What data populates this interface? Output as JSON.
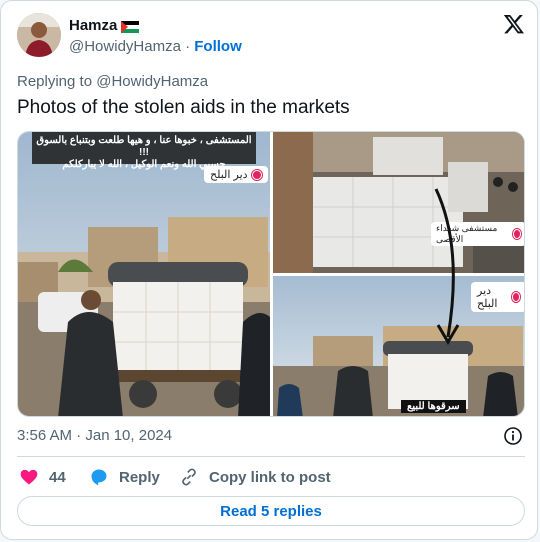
{
  "author": {
    "display_name": "Hamza",
    "handle": "@HowidyHamza",
    "separator": "·",
    "follow_label": "Follow"
  },
  "tweet": {
    "replying_to_prefix": "Replying to ",
    "replying_to_handle": "@HowidyHamza",
    "text": "Photos of the stolen aids in the markets",
    "timestamp": "3:56 AM · Jan 10, 2024"
  },
  "media": {
    "photo1_caption_lines": [
      "المستشفى ، خبوها عنا ، و هيها طلعت وبتنباع بالسوق !!!",
      "حسبي الله ونعم الوكيل ، الله لا يباركلكم"
    ],
    "photo1_location": "دير البلح",
    "photo2_label": "مستشفى شهداء الأقصى",
    "photo3_location": "دير البلح",
    "photo3_caption": "سرقوها للبيع"
  },
  "actions": {
    "like_count": "44",
    "reply_label": "Reply",
    "copy_label": "Copy link to post",
    "read_replies_label": "Read 5 replies"
  },
  "colors": {
    "accent": "#006fd6",
    "like": "#f91880",
    "reply_bubble": "#1d9bf0",
    "muted": "#536471"
  }
}
